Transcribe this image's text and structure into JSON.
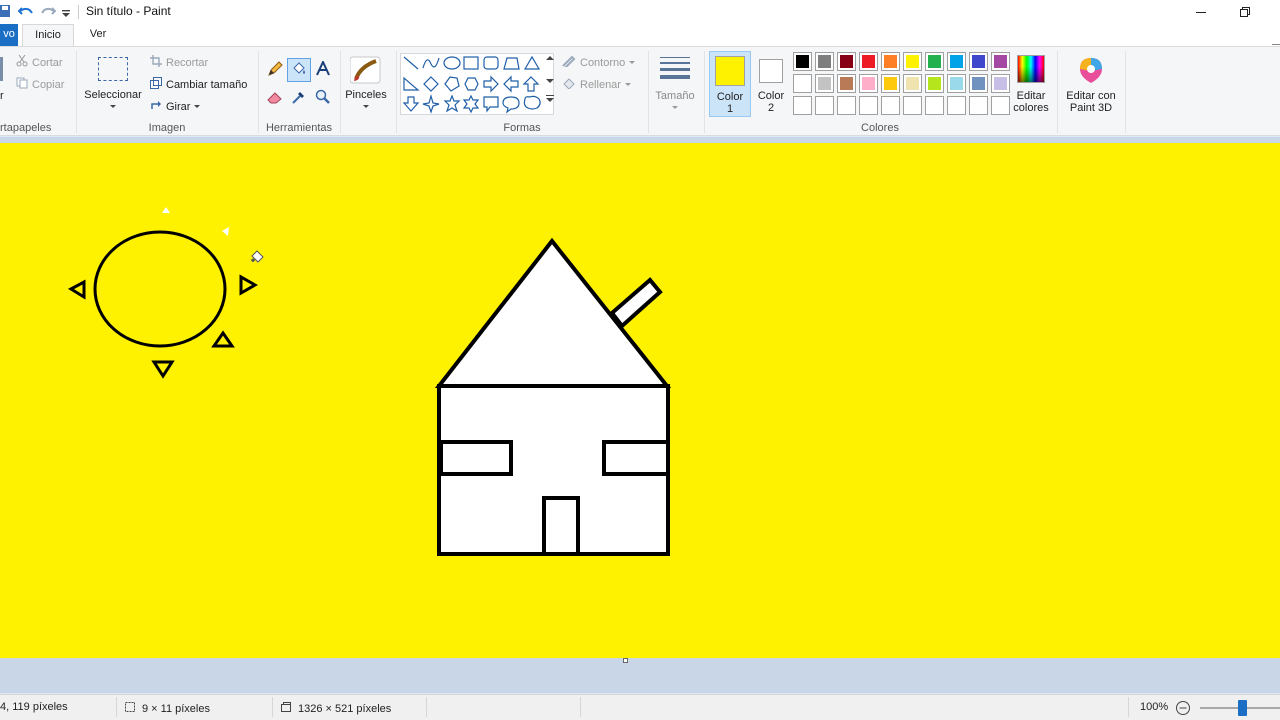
{
  "window": {
    "title": "Sin título - Paint"
  },
  "tabs": {
    "file": "vo",
    "home": "Inicio",
    "view": "Ver"
  },
  "ribbon": {
    "clipboard": {
      "label": "rtapapeles",
      "paste_partial": "r",
      "cut": "Cortar",
      "copy": "Copiar"
    },
    "image": {
      "label": "Imagen",
      "select": "Seleccionar",
      "crop": "Recortar",
      "resize": "Cambiar tamaño",
      "rotate": "Girar"
    },
    "tools": {
      "label": "Herramientas"
    },
    "brushes": {
      "label": "Pinceles"
    },
    "shapes": {
      "label": "Formas",
      "outline": "Contorno",
      "fill": "Rellenar"
    },
    "size": {
      "label": "Tamaño"
    },
    "color1": {
      "line1": "Color",
      "line2": "1",
      "value": "#FFF200"
    },
    "color2": {
      "line1": "Color",
      "line2": "2",
      "value": "#FFFFFF"
    },
    "colors": {
      "label": "Colores",
      "row1": [
        "#000000",
        "#7F7F7F",
        "#880015",
        "#ED1C24",
        "#FF7F27",
        "#FFF200",
        "#22B14C",
        "#00A2E8",
        "#3F48CC",
        "#A349A4"
      ],
      "row2": [
        "#FFFFFF",
        "#C3C3C3",
        "#B97A57",
        "#FFAEC9",
        "#FFC90E",
        "#EFE4B0",
        "#B5E61D",
        "#99D9EA",
        "#7092BE",
        "#C8BFE7"
      ],
      "row3": [
        "#FFFFFF",
        "#FFFFFF",
        "#FFFFFF",
        "#FFFFFF",
        "#FFFFFF",
        "#FFFFFF",
        "#FFFFFF",
        "#FFFFFF",
        "#FFFFFF",
        "#FFFFFF"
      ]
    },
    "edit_colors": {
      "line1": "Editar",
      "line2": "colores"
    },
    "paint3d": {
      "line1": "Editar con",
      "line2": "Paint 3D"
    }
  },
  "canvas": {
    "background": "#FFF200"
  },
  "status": {
    "cursor_pos": "4, 119 píxeles",
    "selection_size": "9 × 11 píxeles",
    "image_size": "1326 × 521 píxeles",
    "zoom": "100%"
  }
}
